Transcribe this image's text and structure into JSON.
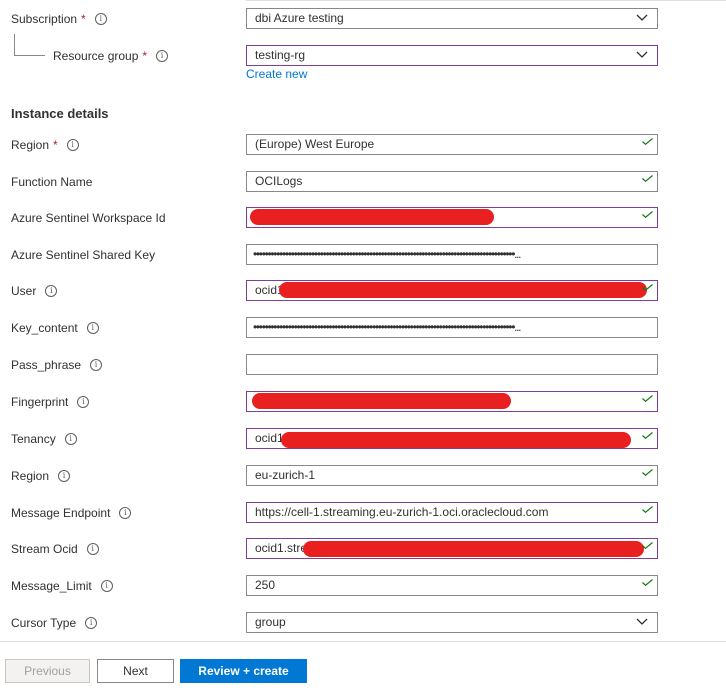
{
  "subscription": {
    "label": "Subscription",
    "value": "dbi Azure testing"
  },
  "resource_group": {
    "label": "Resource group",
    "value": "testing-rg",
    "create_new": "Create new"
  },
  "section_title": "Instance details",
  "fields": {
    "region": {
      "label": "Region",
      "value": "(Europe) West Europe"
    },
    "function_name": {
      "label": "Function Name",
      "value": "OCILogs"
    },
    "workspace_id": {
      "label": "Azure Sentinel Workspace Id",
      "value": ""
    },
    "shared_key": {
      "label": "Azure Sentinel Shared Key",
      "value": "••••••••••••••••••••••••••••••••••••••••••••••••••••••••••••••••••••••••••••••••••••••••••..."
    },
    "user": {
      "label": "User",
      "value": "ocid1"
    },
    "key_content": {
      "label": "Key_content",
      "value": "••••••••••••••••••••••••••••••••••••••••••••••••••••••••••••••••••••••••••••••••••••••••••..."
    },
    "pass_phrase": {
      "label": "Pass_phrase",
      "value": ""
    },
    "fingerprint": {
      "label": "Fingerprint",
      "value": ""
    },
    "tenancy": {
      "label": "Tenancy",
      "value": "ocid1"
    },
    "oci_region": {
      "label": "Region",
      "value": "eu-zurich-1"
    },
    "message_endpoint": {
      "label": "Message Endpoint",
      "value": "https://cell-1.streaming.eu-zurich-1.oci.oraclecloud.com"
    },
    "stream_ocid": {
      "label": "Stream Ocid",
      "value": "ocid1.stre"
    },
    "message_limit": {
      "label": "Message_Limit",
      "value": "250"
    },
    "cursor_type": {
      "label": "Cursor Type",
      "value": "group"
    }
  },
  "buttons": {
    "previous": "Previous",
    "next": "Next",
    "create": "Review + create"
  },
  "colors": {
    "accent": "#0078d4",
    "required": "#a4262c",
    "valid": "#107c10",
    "focus_border": "#7f3f98",
    "redaction": "#e8201f"
  }
}
